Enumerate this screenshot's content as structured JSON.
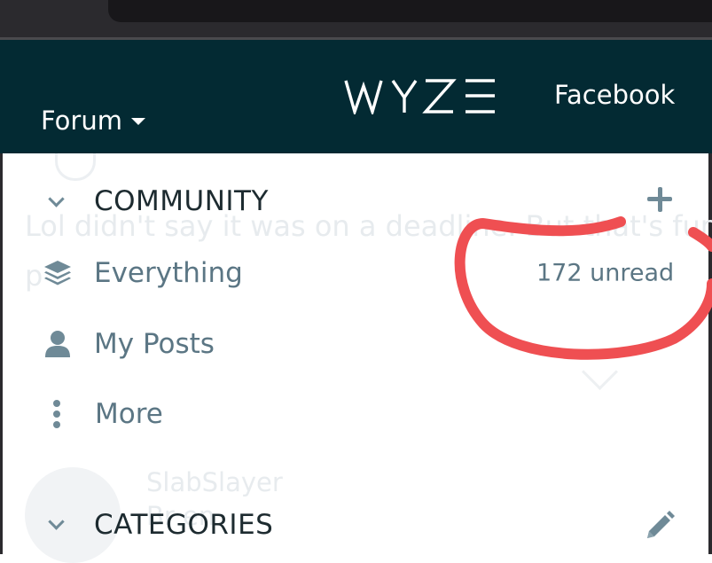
{
  "header": {
    "forum_label": "Forum",
    "logo_text": "WYZE",
    "facebook_label": "Facebook"
  },
  "background": {
    "ghost_line_1": "Lol didn't say it was on a deadline. But that's fun",
    "ghost_line_2": "p",
    "ghost_user": "SlabSlayer",
    "ghost_sub": "Br   en"
  },
  "sidebar": {
    "community": {
      "title": "COMMUNITY",
      "items": [
        {
          "label": "Everything",
          "icon": "layers-icon",
          "badge": "172 unread"
        },
        {
          "label": "My Posts",
          "icon": "user-icon"
        },
        {
          "label": "More",
          "icon": "vertical-ellipsis-icon"
        }
      ]
    },
    "categories": {
      "title": "CATEGORIES"
    }
  },
  "colors": {
    "header_bg": "#032a33",
    "nav_text": "#5b7684",
    "icon": "#6f8a97",
    "annotation": "#ef4f52"
  }
}
